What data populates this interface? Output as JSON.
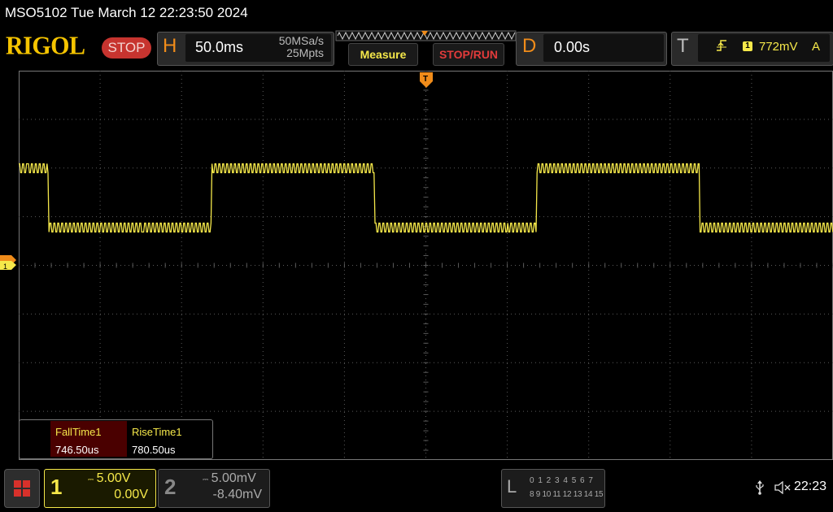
{
  "titlebar": {
    "text": "MSO5102  Tue March 12 22:23:50 2024"
  },
  "topbar": {
    "logo": "RIGOL",
    "run_state": "STOP",
    "horizontal": {
      "letter": "H",
      "timebase": "50.0ms",
      "sample_rate": "50MSa/s",
      "memory_depth": "25Mpts"
    },
    "measure_label": "Measure",
    "stoprun_label": "STOP/RUN",
    "delay": {
      "letter": "D",
      "value": "0.00s"
    },
    "trigger": {
      "letter": "T",
      "source": "1",
      "level": "772mV",
      "mode": "A",
      "slope_icon": "rising-edge-icon"
    }
  },
  "colors": {
    "ch1": "#f5e84a",
    "accent_orange": "#f08c1a",
    "stop_red": "#c7342f",
    "grid": "#5a5a5a",
    "stoprun_text": "#e23b3b"
  },
  "markers": {
    "ch1_marker": "1",
    "trigger_marker": "T"
  },
  "measurements": [
    {
      "label": "FallTime1",
      "value": "746.50us"
    },
    {
      "label": "RiseTime1",
      "value": "780.50us"
    }
  ],
  "channels": [
    {
      "number": "1",
      "scale": "5.00V",
      "offset": "0.00V",
      "active": true
    },
    {
      "number": "2",
      "scale": "5.00mV",
      "offset": "-8.40mV",
      "active": false
    }
  ],
  "logic": {
    "letter": "L",
    "row1": "0 1 2 3  4 5 6 7",
    "row2": "8 9 10 11 12 13 14 15"
  },
  "status": {
    "clock": "22:23",
    "usb_icon": "usb-icon",
    "speaker_icon": "speaker-muted-icon"
  }
}
